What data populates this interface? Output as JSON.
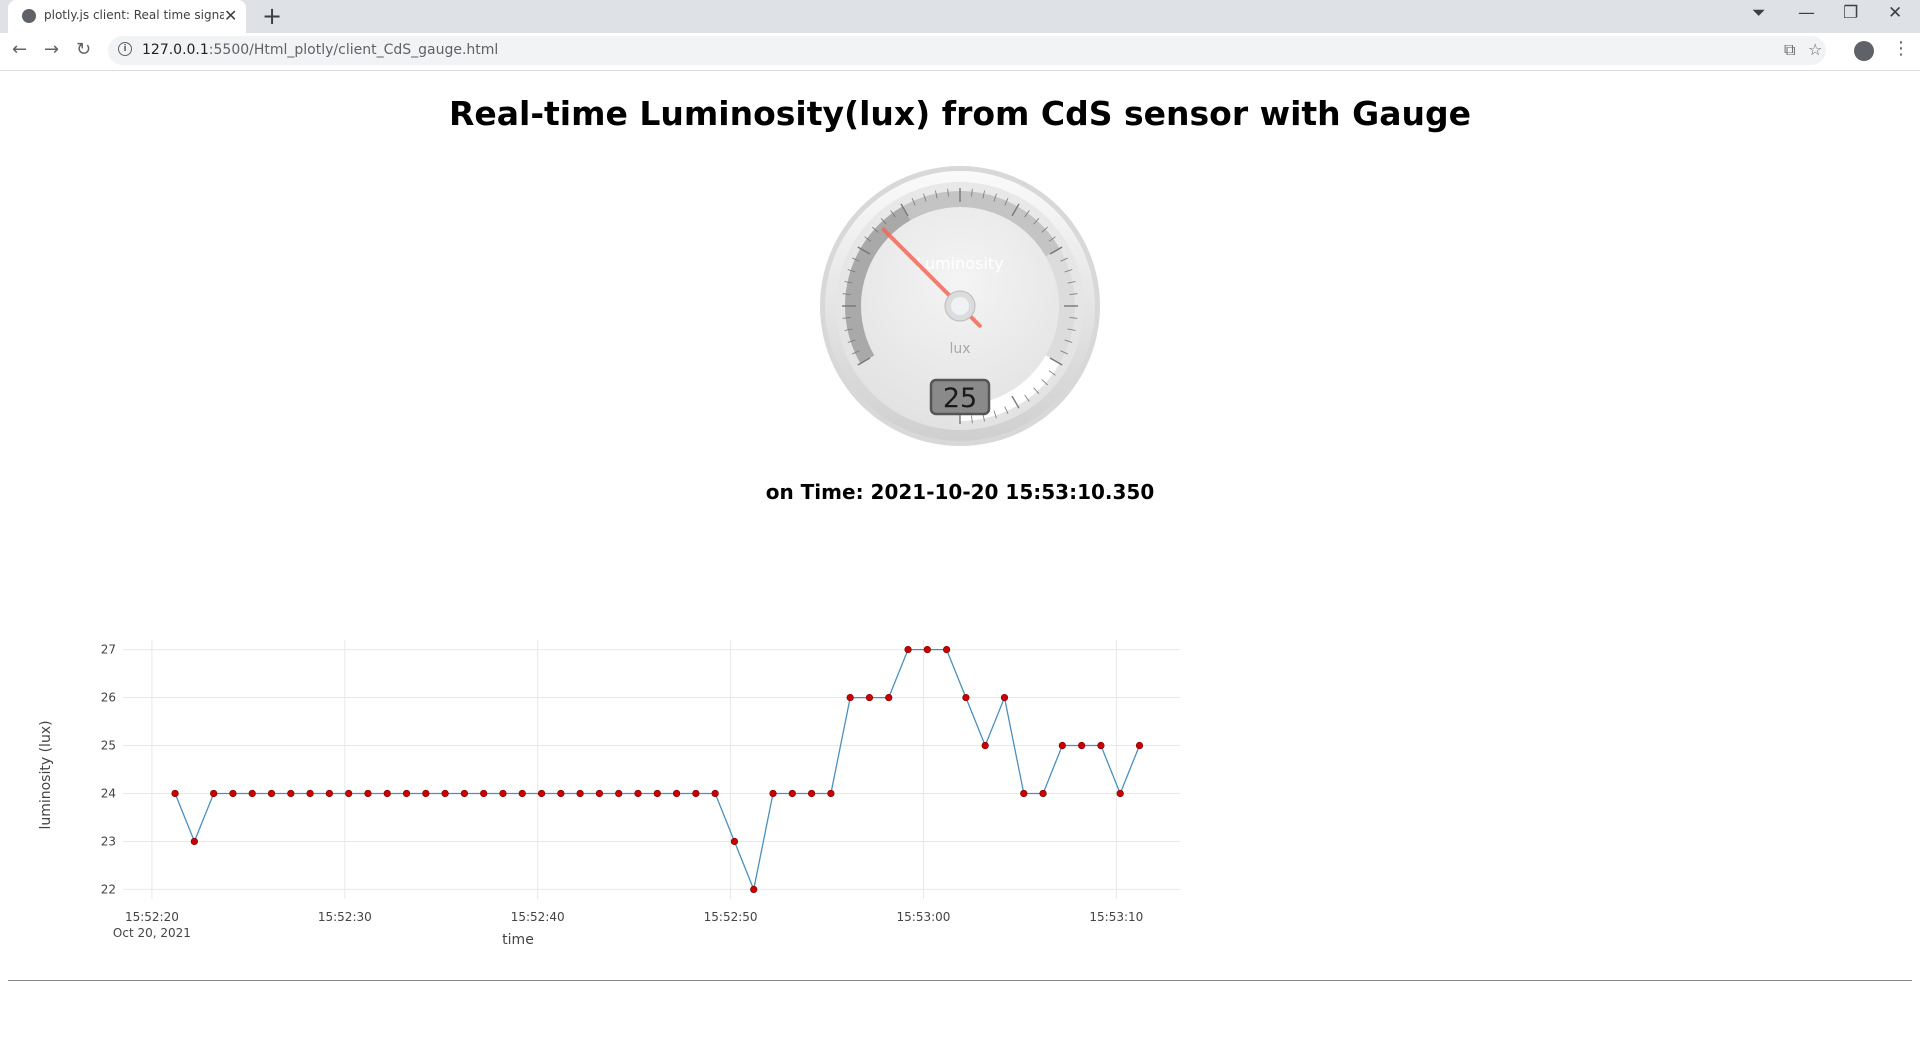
{
  "browser": {
    "tab_title": "plotly.js client: Real time signals",
    "new_tab_label": "+",
    "url_host": "127.0.0.1",
    "url_path": ":5500/Html_plotly/client_CdS_gauge.html"
  },
  "page": {
    "title": "Real-time Luminosity(lux) from CdS sensor with Gauge",
    "time_text": "on Time: 2021-10-20 15:53:10.350"
  },
  "gauge": {
    "title": "Luminosity",
    "units": "lux",
    "value": 25,
    "value_text": "25",
    "min": 0,
    "max": 100,
    "needle_color": "#f06a5a",
    "highlight_color": "#b0b0b0"
  },
  "chart_data": {
    "type": "line",
    "xlabel": "time",
    "ylabel": "luminosity (lux)",
    "ylim": [
      21.8,
      27.2
    ],
    "yticks": [
      22,
      23,
      24,
      25,
      26,
      27
    ],
    "xticks": [
      {
        "t": 0,
        "label": "15:52:20",
        "sub": "Oct 20, 2021"
      },
      {
        "t": 10,
        "label": "15:52:30",
        "sub": ""
      },
      {
        "t": 20,
        "label": "15:52:40",
        "sub": ""
      },
      {
        "t": 30,
        "label": "15:52:50",
        "sub": ""
      },
      {
        "t": 40,
        "label": "15:53:00",
        "sub": ""
      },
      {
        "t": 50,
        "label": "15:53:10",
        "sub": ""
      }
    ],
    "xlim": [
      -1.5,
      53.3
    ],
    "x_start": 1.2,
    "x_step": 1.0,
    "values": [
      24,
      23,
      24,
      24,
      24,
      24,
      24,
      24,
      24,
      24,
      24,
      24,
      24,
      24,
      24,
      24,
      24,
      24,
      24,
      24,
      24,
      24,
      24,
      24,
      24,
      24,
      24,
      24,
      24,
      23,
      22,
      24,
      24,
      24,
      24,
      26,
      26,
      26,
      27,
      27,
      27,
      26,
      25,
      26,
      24,
      24,
      25,
      25,
      25,
      24,
      25
    ],
    "line_color": "#4a90c0",
    "marker_color": "#cc0000",
    "grid": true
  }
}
